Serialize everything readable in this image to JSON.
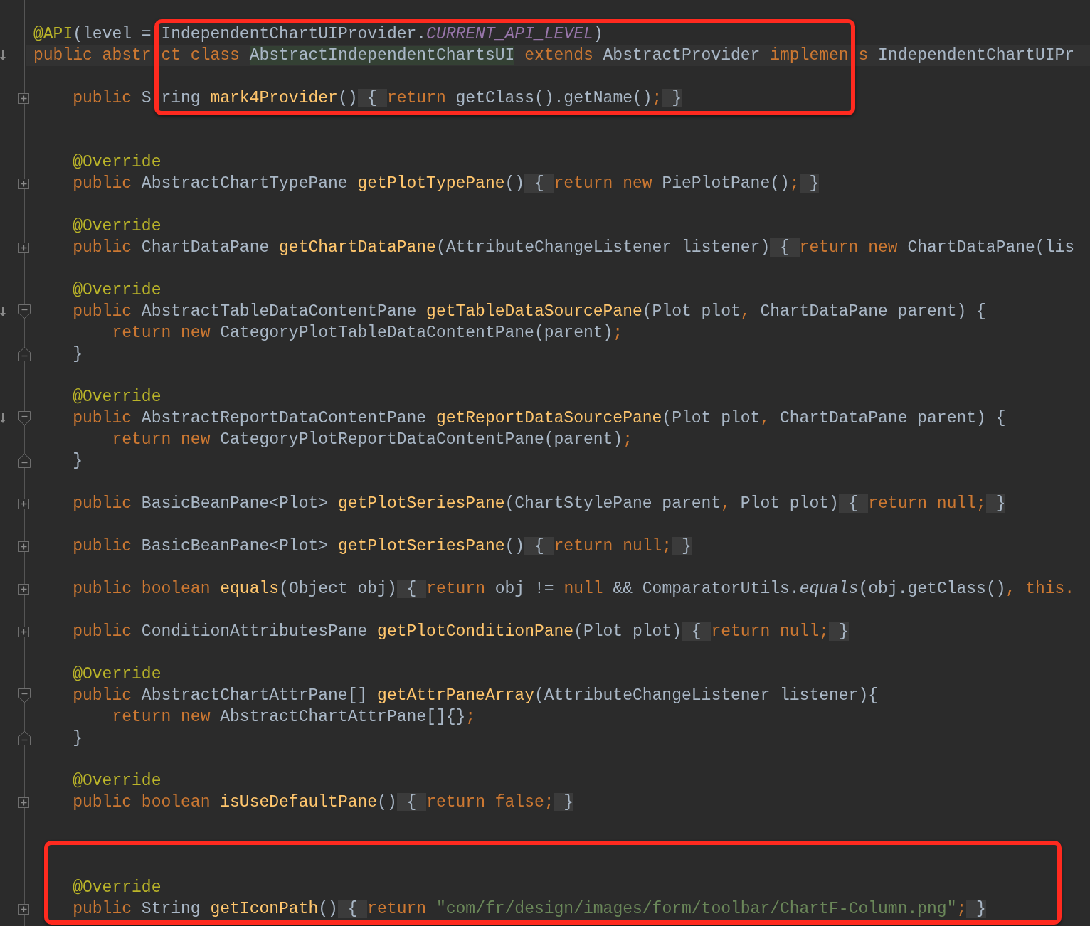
{
  "lines": [
    {
      "kind": "code",
      "framed": true,
      "tokens": [
        {
          "kind": "ann",
          "text": "@API"
        },
        {
          "kind": "plain",
          "text": "(level = IndependentChartUIProvider."
        },
        {
          "kind": "static",
          "text": "CURRENT_API_LEVEL"
        },
        {
          "kind": "plain",
          "text": ")"
        }
      ]
    },
    {
      "kind": "code",
      "framed": true,
      "current": true,
      "gutter_mark": true,
      "tokens": [
        {
          "kind": "kw",
          "text": "public abstr"
        },
        {
          "kind": "gap"
        },
        {
          "kind": "kw",
          "text": "ct class "
        },
        {
          "kind": "classdecl",
          "text": "AbstractIndependentChartsUI"
        },
        {
          "kind": "kw",
          "text": " extends"
        },
        {
          "kind": "plain",
          "text": " AbstractProvider "
        },
        {
          "kind": "kw",
          "text": "implemen"
        },
        {
          "kind": "gap"
        },
        {
          "kind": "kw",
          "text": "s"
        },
        {
          "kind": "plain",
          "text": " IndependentChartUIPr"
        }
      ]
    },
    {
      "kind": "blank",
      "framed": true
    },
    {
      "kind": "code",
      "framed": true,
      "folded": true,
      "tokens": [
        {
          "kind": "kw",
          "text": "    public "
        },
        {
          "kind": "plain",
          "text": "S"
        },
        {
          "kind": "gap"
        },
        {
          "kind": "plain",
          "text": "ring "
        },
        {
          "kind": "decl",
          "text": "mark4Provider"
        },
        {
          "kind": "plain",
          "text": "()"
        },
        {
          "kind": "fold",
          "text": " { "
        },
        {
          "kind": "kw",
          "text": "return "
        },
        {
          "kind": "plain",
          "text": "getClass().getName()"
        },
        {
          "kind": "kw",
          "text": ";"
        },
        {
          "kind": "fold",
          "text": " }"
        }
      ]
    },
    {
      "kind": "blank"
    },
    {
      "kind": "blank"
    },
    {
      "kind": "code",
      "tokens": [
        {
          "kind": "ann",
          "text": "    @Override"
        }
      ]
    },
    {
      "kind": "code",
      "folded": true,
      "tokens": [
        {
          "kind": "kw",
          "text": "    public "
        },
        {
          "kind": "plain",
          "text": "AbstractChartTypePane "
        },
        {
          "kind": "decl",
          "text": "getPlotTypePane"
        },
        {
          "kind": "plain",
          "text": "()"
        },
        {
          "kind": "fold",
          "text": " { "
        },
        {
          "kind": "kw",
          "text": "return new "
        },
        {
          "kind": "plain",
          "text": "PiePlotPane()"
        },
        {
          "kind": "kw",
          "text": ";"
        },
        {
          "kind": "fold",
          "text": " }"
        }
      ]
    },
    {
      "kind": "blank"
    },
    {
      "kind": "code",
      "tokens": [
        {
          "kind": "ann",
          "text": "    @Override"
        }
      ]
    },
    {
      "kind": "code",
      "folded": true,
      "tokens": [
        {
          "kind": "kw",
          "text": "    public "
        },
        {
          "kind": "plain",
          "text": "ChartDataPane "
        },
        {
          "kind": "decl",
          "text": "getChartDataPane"
        },
        {
          "kind": "plain",
          "text": "(AttributeChangeListener listener)"
        },
        {
          "kind": "fold",
          "text": " { "
        },
        {
          "kind": "kw",
          "text": "return new "
        },
        {
          "kind": "plain",
          "text": "ChartDataPane(lis"
        }
      ]
    },
    {
      "kind": "blank"
    },
    {
      "kind": "code",
      "tokens": [
        {
          "kind": "ann",
          "text": "    @Override"
        }
      ]
    },
    {
      "kind": "code",
      "gutter_mark": true,
      "block_start": true,
      "tokens": [
        {
          "kind": "kw",
          "text": "    public "
        },
        {
          "kind": "plain",
          "text": "AbstractTableDataContentPane "
        },
        {
          "kind": "decl",
          "text": "getTableDataSourcePane"
        },
        {
          "kind": "plain",
          "text": "(Plot plot"
        },
        {
          "kind": "kw",
          "text": ", "
        },
        {
          "kind": "plain",
          "text": "ChartDataPane parent) {"
        }
      ]
    },
    {
      "kind": "code",
      "tokens": [
        {
          "kind": "kw",
          "text": "        return new "
        },
        {
          "kind": "plain",
          "text": "CategoryPlotTableDataContentPane(parent)"
        },
        {
          "kind": "kw",
          "text": ";"
        }
      ]
    },
    {
      "kind": "code",
      "block_end": true,
      "tokens": [
        {
          "kind": "plain",
          "text": "    }"
        }
      ]
    },
    {
      "kind": "blank"
    },
    {
      "kind": "code",
      "tokens": [
        {
          "kind": "ann",
          "text": "    @Override"
        }
      ]
    },
    {
      "kind": "code",
      "gutter_mark": true,
      "block_start": true,
      "tokens": [
        {
          "kind": "kw",
          "text": "    public "
        },
        {
          "kind": "plain",
          "text": "AbstractReportDataContentPane "
        },
        {
          "kind": "decl",
          "text": "getReportDataSourcePane"
        },
        {
          "kind": "plain",
          "text": "(Plot plot"
        },
        {
          "kind": "kw",
          "text": ", "
        },
        {
          "kind": "plain",
          "text": "ChartDataPane parent) {"
        }
      ]
    },
    {
      "kind": "code",
      "tokens": [
        {
          "kind": "kw",
          "text": "        return new "
        },
        {
          "kind": "plain",
          "text": "CategoryPlotReportDataContentPane(parent)"
        },
        {
          "kind": "kw",
          "text": ";"
        }
      ]
    },
    {
      "kind": "code",
      "block_end": true,
      "tokens": [
        {
          "kind": "plain",
          "text": "    }"
        }
      ]
    },
    {
      "kind": "blank"
    },
    {
      "kind": "code",
      "folded": true,
      "tokens": [
        {
          "kind": "kw",
          "text": "    public "
        },
        {
          "kind": "plain",
          "text": "BasicBeanPane<Plot> "
        },
        {
          "kind": "decl",
          "text": "getPlotSeriesPane"
        },
        {
          "kind": "plain",
          "text": "(ChartStylePane parent"
        },
        {
          "kind": "kw",
          "text": ", "
        },
        {
          "kind": "plain",
          "text": "Plot plot)"
        },
        {
          "kind": "fold",
          "text": " { "
        },
        {
          "kind": "kw",
          "text": "return null;"
        },
        {
          "kind": "fold",
          "text": " }"
        }
      ]
    },
    {
      "kind": "blank"
    },
    {
      "kind": "code",
      "folded": true,
      "tokens": [
        {
          "kind": "kw",
          "text": "    public "
        },
        {
          "kind": "plain",
          "text": "BasicBeanPane<Plot> "
        },
        {
          "kind": "decl",
          "text": "getPlotSeriesPane"
        },
        {
          "kind": "plain",
          "text": "()"
        },
        {
          "kind": "fold",
          "text": " { "
        },
        {
          "kind": "kw",
          "text": "return null;"
        },
        {
          "kind": "fold",
          "text": " }"
        }
      ]
    },
    {
      "kind": "blank"
    },
    {
      "kind": "code",
      "folded": true,
      "tokens": [
        {
          "kind": "kw",
          "text": "    public boolean "
        },
        {
          "kind": "decl",
          "text": "equals"
        },
        {
          "kind": "plain",
          "text": "(Object obj)"
        },
        {
          "kind": "fold",
          "text": " { "
        },
        {
          "kind": "kw",
          "text": "return "
        },
        {
          "kind": "plain",
          "text": "obj != "
        },
        {
          "kind": "kw",
          "text": "null "
        },
        {
          "kind": "plain",
          "text": "&& ComparatorUtils."
        },
        {
          "kind": "italic",
          "text": "equals"
        },
        {
          "kind": "plain",
          "text": "(obj.getClass()"
        },
        {
          "kind": "kw",
          "text": ", this."
        }
      ]
    },
    {
      "kind": "blank"
    },
    {
      "kind": "code",
      "folded": true,
      "tokens": [
        {
          "kind": "kw",
          "text": "    public "
        },
        {
          "kind": "plain",
          "text": "ConditionAttributesPane "
        },
        {
          "kind": "decl",
          "text": "getPlotConditionPane"
        },
        {
          "kind": "plain",
          "text": "(Plot plot)"
        },
        {
          "kind": "fold",
          "text": " { "
        },
        {
          "kind": "kw",
          "text": "return null;"
        },
        {
          "kind": "fold",
          "text": " }"
        }
      ]
    },
    {
      "kind": "blank"
    },
    {
      "kind": "code",
      "tokens": [
        {
          "kind": "ann",
          "text": "    @Override"
        }
      ]
    },
    {
      "kind": "code",
      "block_start": true,
      "tokens": [
        {
          "kind": "kw",
          "text": "    public "
        },
        {
          "kind": "plain",
          "text": "AbstractChartAttrPane[] "
        },
        {
          "kind": "decl",
          "text": "getAttrPaneArray"
        },
        {
          "kind": "plain",
          "text": "(AttributeChangeListener listener){"
        }
      ]
    },
    {
      "kind": "code",
      "tokens": [
        {
          "kind": "kw",
          "text": "        return new "
        },
        {
          "kind": "plain",
          "text": "AbstractChartAttrPane[]{}"
        },
        {
          "kind": "kw",
          "text": ";"
        }
      ]
    },
    {
      "kind": "code",
      "block_end": true,
      "tokens": [
        {
          "kind": "plain",
          "text": "    }"
        }
      ]
    },
    {
      "kind": "blank"
    },
    {
      "kind": "code",
      "tokens": [
        {
          "kind": "ann",
          "text": "    @Override"
        }
      ]
    },
    {
      "kind": "code",
      "folded": true,
      "tokens": [
        {
          "kind": "kw",
          "text": "    public boolean "
        },
        {
          "kind": "decl",
          "text": "isUseDefaultPane"
        },
        {
          "kind": "plain",
          "text": "()"
        },
        {
          "kind": "fold",
          "text": " { "
        },
        {
          "kind": "kw",
          "text": "return false;"
        },
        {
          "kind": "fold",
          "text": " }"
        }
      ]
    },
    {
      "kind": "blank"
    },
    {
      "kind": "blank"
    },
    {
      "kind": "blank",
      "framed": true
    },
    {
      "kind": "code",
      "framed": true,
      "tokens": [
        {
          "kind": "ann",
          "text": "    @Override"
        }
      ]
    },
    {
      "kind": "code",
      "framed": true,
      "folded": true,
      "tokens": [
        {
          "kind": "kw",
          "text": "    public "
        },
        {
          "kind": "plain",
          "text": "String "
        },
        {
          "kind": "decl",
          "text": "getIconPath"
        },
        {
          "kind": "plain",
          "text": "()"
        },
        {
          "kind": "fold",
          "text": " { "
        },
        {
          "kind": "kw",
          "text": "return "
        },
        {
          "kind": "str",
          "text": "\"com/fr/design/images/form/toolbar/ChartF-Column.png\""
        },
        {
          "kind": "kw",
          "text": ";"
        },
        {
          "kind": "fold",
          "text": " }"
        }
      ]
    }
  ]
}
